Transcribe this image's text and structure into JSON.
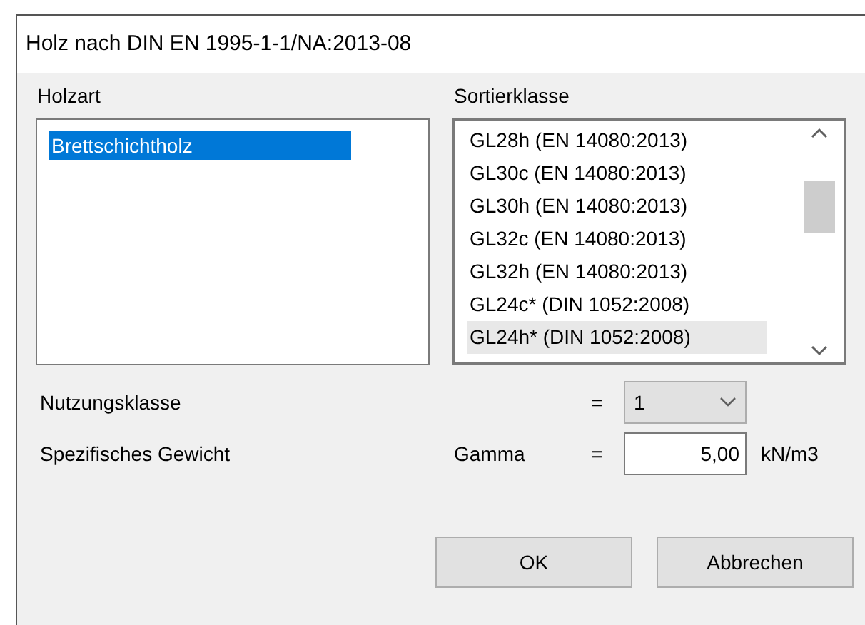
{
  "window": {
    "title": "Holz nach DIN EN 1995-1-1/NA:2013-08"
  },
  "wood_type": {
    "label": "Holzart",
    "items": [
      {
        "label": "Brettschichtholz",
        "selected": true
      }
    ]
  },
  "grade": {
    "label": "Sortierklasse",
    "items": [
      {
        "label": "GL28h (EN 14080:2013)",
        "selected": false
      },
      {
        "label": "GL30c (EN 14080:2013)",
        "selected": false
      },
      {
        "label": "GL30h (EN 14080:2013)",
        "selected": false
      },
      {
        "label": "GL32c (EN 14080:2013)",
        "selected": false
      },
      {
        "label": "GL32h (EN 14080:2013)",
        "selected": false
      },
      {
        "label": "GL24c* (DIN 1052:2008)",
        "selected": false
      },
      {
        "label": "GL24h* (DIN 1052:2008)",
        "selected": true
      }
    ]
  },
  "service_class": {
    "label": "Nutzungsklasse",
    "equals": "=",
    "value": "1"
  },
  "specific_weight": {
    "label": "Spezifisches Gewicht",
    "symbol": "Gamma",
    "equals": "=",
    "value": "5,00",
    "unit": "kN/m3"
  },
  "buttons": [
    "OK",
    "Abbrechen"
  ]
}
